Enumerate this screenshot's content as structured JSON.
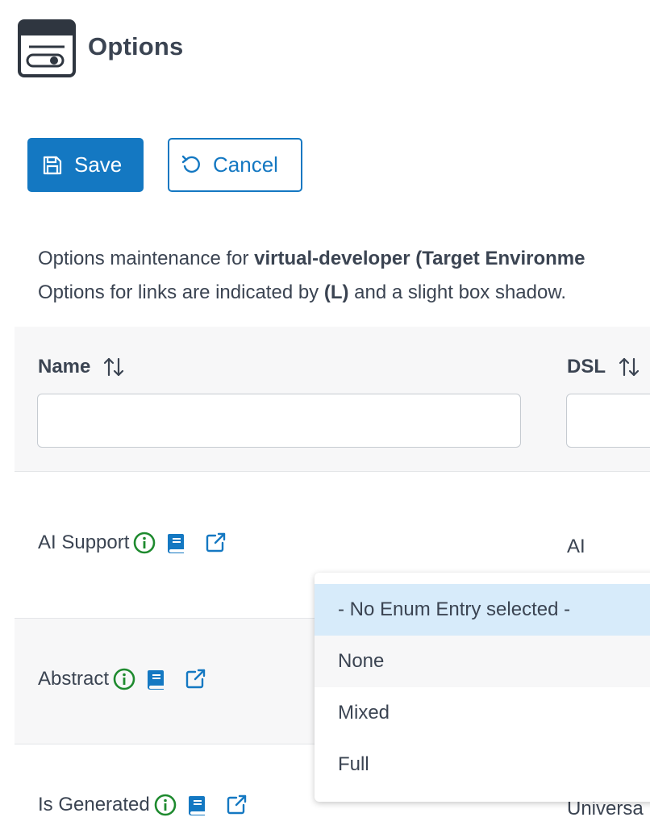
{
  "header": {
    "title": "Options",
    "icon": "options-window-icon"
  },
  "toolbar": {
    "save_label": "Save",
    "cancel_label": "Cancel",
    "accent_color": "#1478c2"
  },
  "description": {
    "line1_prefix": "Options maintenance for ",
    "line1_bold": "virtual-developer (Target Environme",
    "line2_prefix": "Options for links are indicated by ",
    "line2_bold": "(L)",
    "line2_suffix": " and a slight box shadow."
  },
  "table": {
    "columns": [
      {
        "label": "Name",
        "sortable": true
      },
      {
        "label": "DSL",
        "sortable": true
      }
    ],
    "filters": {
      "name_value": "",
      "dsl_value": ""
    },
    "rows": [
      {
        "name": "AI Support",
        "dsl": "AI"
      },
      {
        "name": "Abstract",
        "dsl": ""
      },
      {
        "name": "Is Generated",
        "dsl": "Universa"
      }
    ],
    "row_icons": [
      "info-icon",
      "book-icon",
      "external-link-icon"
    ],
    "info_color": "#1e8a2e",
    "link_color": "#1478c2"
  },
  "dropdown": {
    "options": [
      "- No Enum Entry selected -",
      "None",
      "Mixed",
      "Full"
    ],
    "selected_index": 0,
    "selected_color": "#d7ebfa"
  }
}
